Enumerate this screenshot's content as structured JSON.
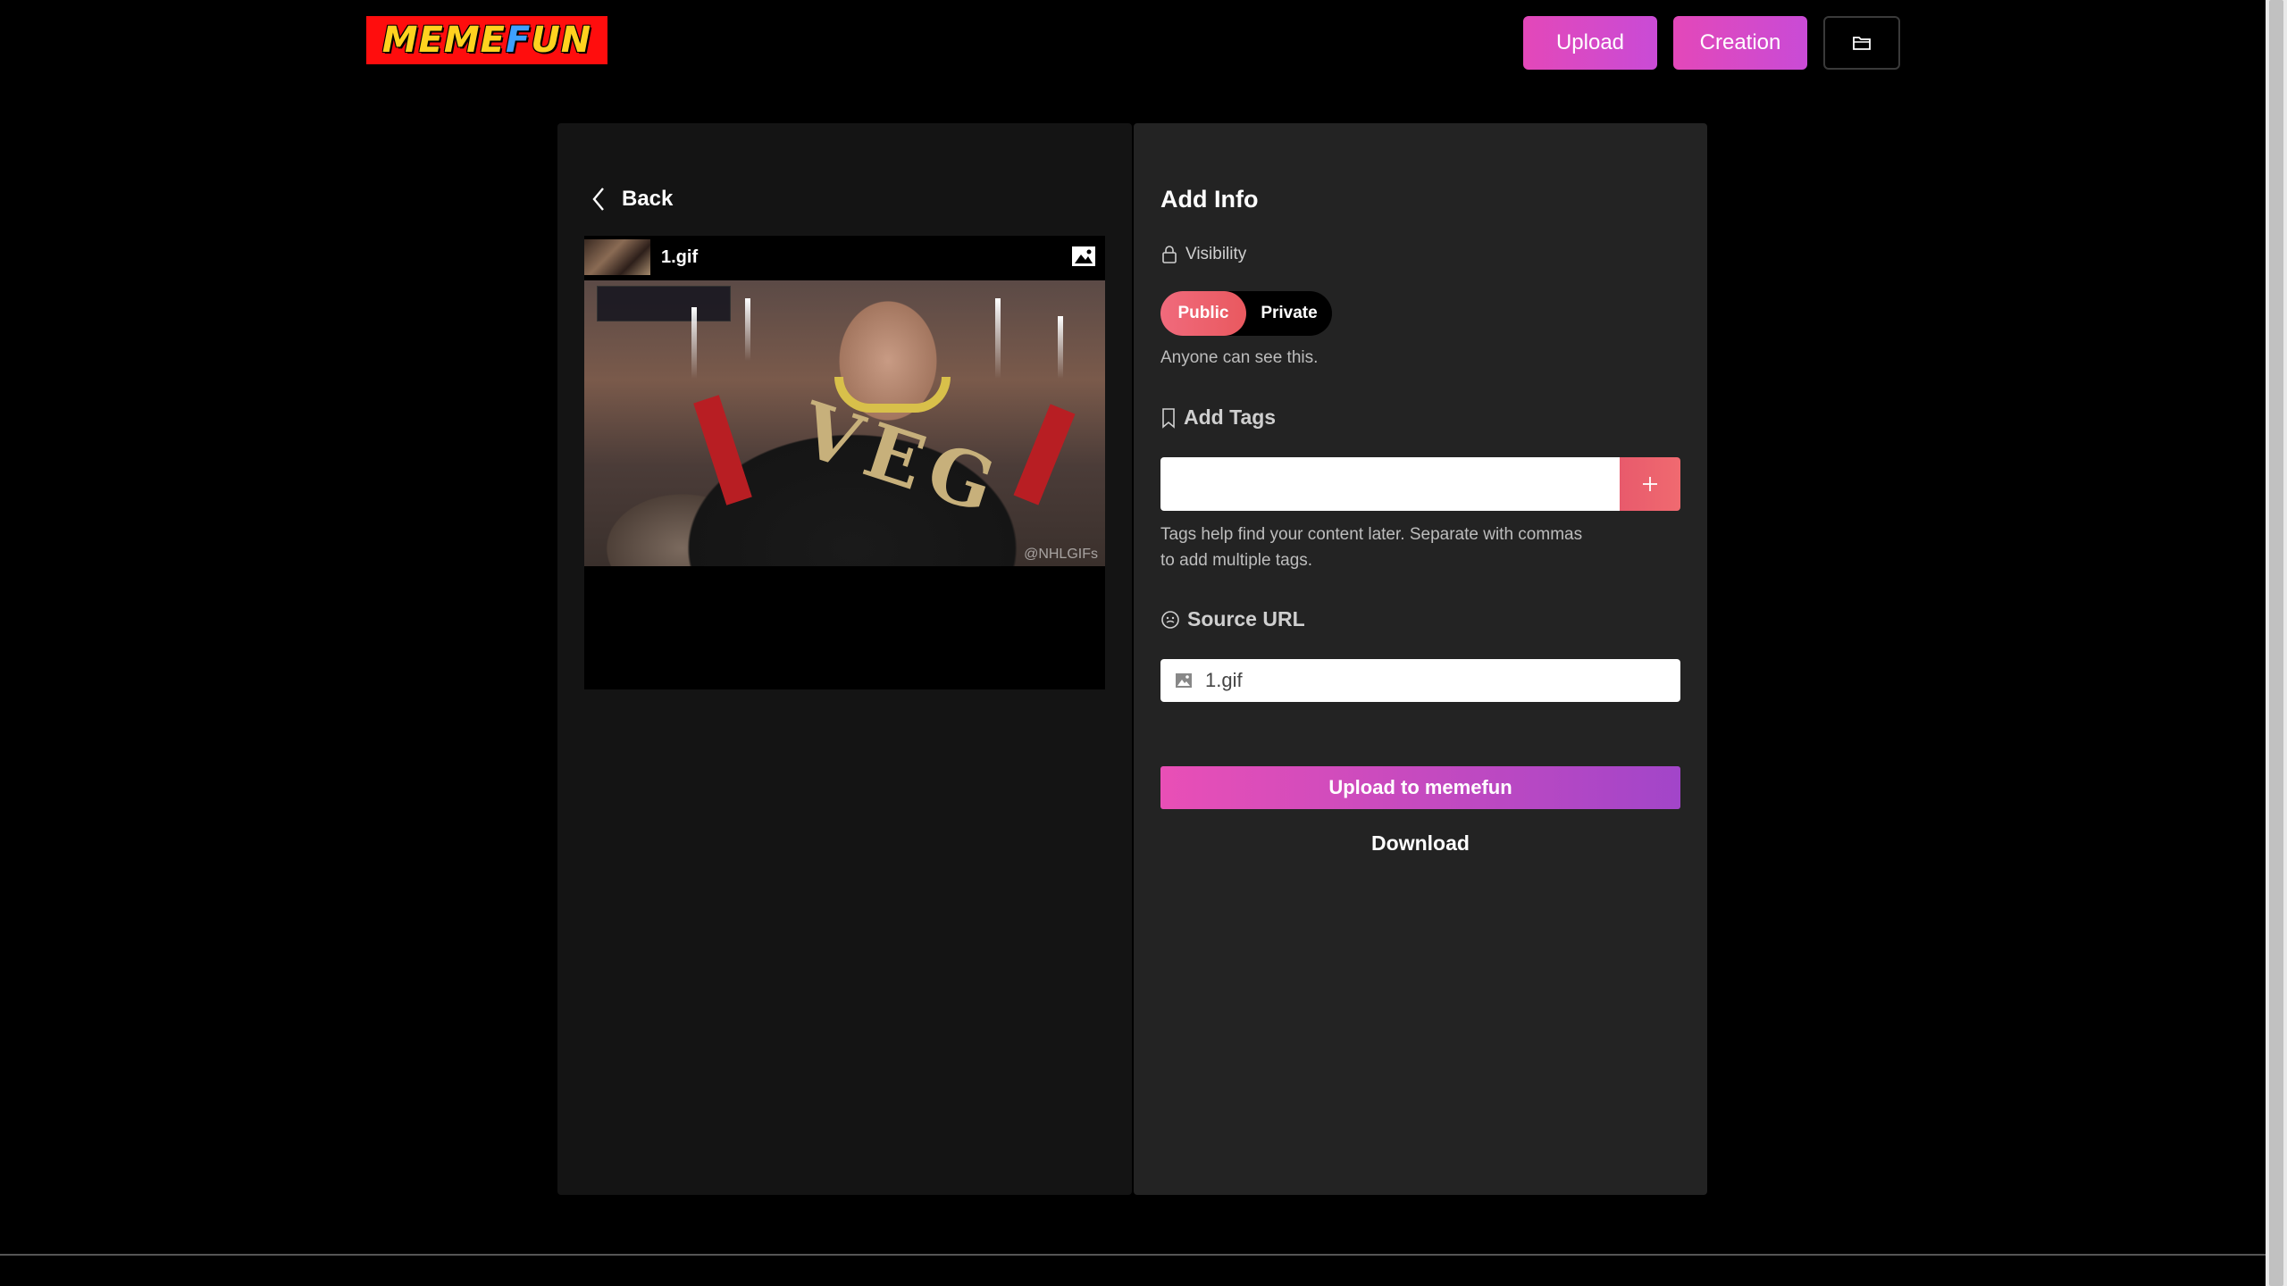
{
  "header": {
    "logo": {
      "part1": "MEME",
      "part2": "F",
      "part3": "UN"
    },
    "upload_label": "Upload",
    "creation_label": "Creation",
    "folder_icon": "folder-icon"
  },
  "left": {
    "back_label": "Back",
    "file_name": "1.gif",
    "watermark": "@NHLGIFs"
  },
  "right": {
    "title": "Add Info",
    "visibility_label": "Visibility",
    "visibility_options": [
      "Public",
      "Private"
    ],
    "visibility_selected": "Public",
    "visibility_help": "Anyone can see this.",
    "tags_label": "Add Tags",
    "tags_value": "",
    "tags_help": "Tags help find your content later. Separate with commas to add multiple tags.",
    "source_label": "Source URL",
    "source_value": "1.gif",
    "upload_cta": "Upload to memefun",
    "download_label": "Download"
  },
  "colors": {
    "accent_pink": "#e348b9",
    "accent_purple": "#a245c9",
    "toggle_active": "#f06a7c"
  }
}
